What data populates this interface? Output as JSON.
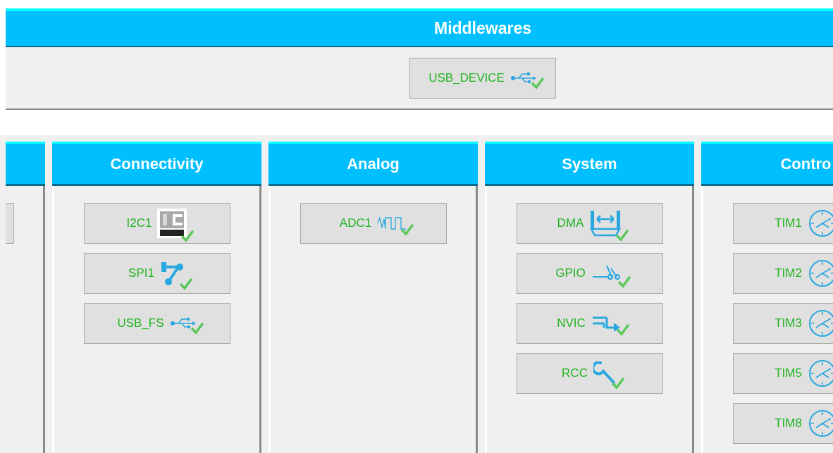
{
  "middlewares": {
    "title": "Middlewares",
    "items": [
      {
        "label": "USB_DEVICE",
        "kind": "usb",
        "configured": true
      }
    ]
  },
  "categories": [
    {
      "title": "Connectivity",
      "items": [
        {
          "label": "I2C1",
          "kind": "i2c",
          "configured": true
        },
        {
          "label": "SPI1",
          "kind": "spi",
          "configured": true
        },
        {
          "label": "USB_FS",
          "kind": "usb",
          "configured": true
        }
      ]
    },
    {
      "title": "Analog",
      "items": [
        {
          "label": "ADC1",
          "kind": "adc",
          "configured": true
        }
      ]
    },
    {
      "title": "System",
      "items": [
        {
          "label": "DMA",
          "kind": "dma",
          "configured": true
        },
        {
          "label": "GPIO",
          "kind": "gpio",
          "configured": true
        },
        {
          "label": "NVIC",
          "kind": "nvic",
          "configured": true
        },
        {
          "label": "RCC",
          "kind": "rcc",
          "configured": true
        }
      ]
    },
    {
      "title": "Contro",
      "items": [
        {
          "label": "TIM1",
          "kind": "timer"
        },
        {
          "label": "TIM2",
          "kind": "timer"
        },
        {
          "label": "TIM3",
          "kind": "timer"
        },
        {
          "label": "TIM5",
          "kind": "timer"
        },
        {
          "label": "TIM8",
          "kind": "timer"
        }
      ]
    }
  ]
}
